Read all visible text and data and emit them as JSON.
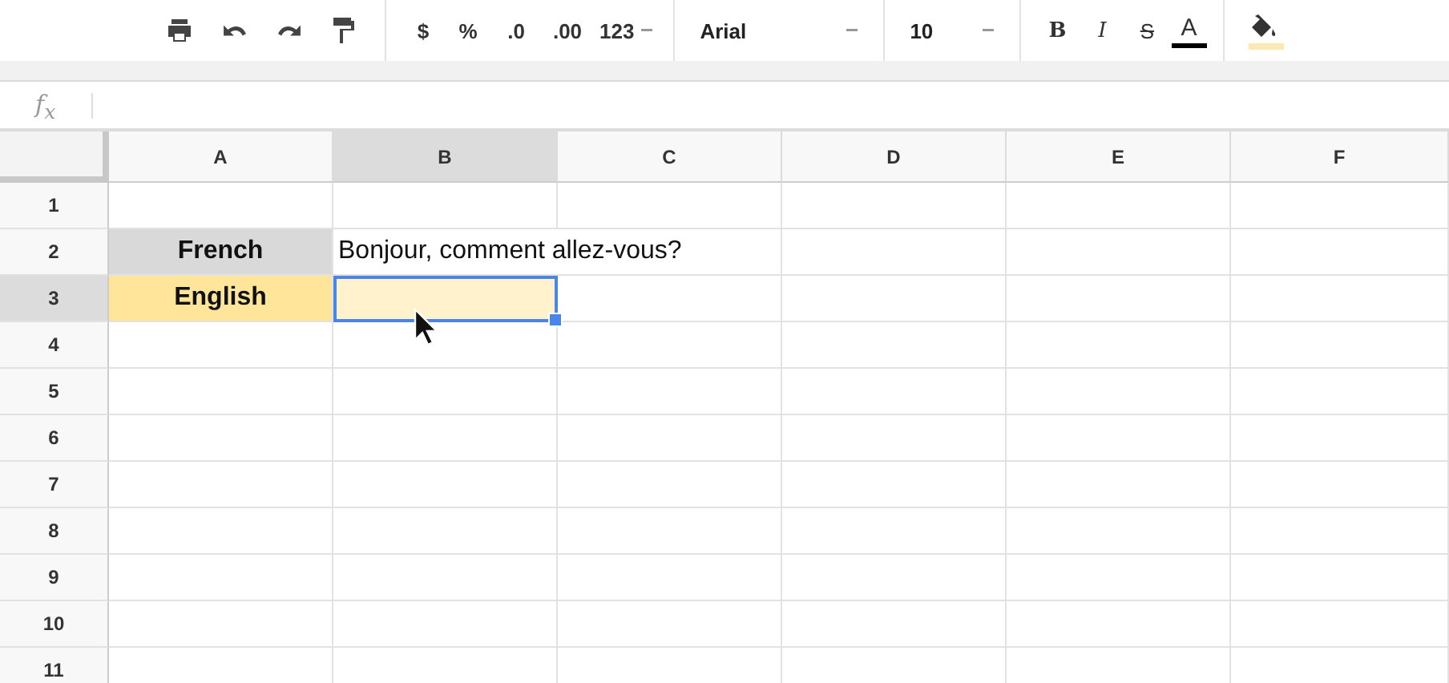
{
  "toolbar": {
    "groups": [
      [
        {
          "kind": "print"
        },
        {
          "kind": "undo"
        },
        {
          "kind": "redo"
        },
        {
          "kind": "paint-format"
        }
      ],
      [
        {
          "kind": "text",
          "label": "$"
        },
        {
          "kind": "text",
          "label": "%"
        },
        {
          "kind": "decimal-less",
          "label": ".0"
        },
        {
          "kind": "decimal-more",
          "label": ".00"
        },
        {
          "kind": "dropdown",
          "label": "123"
        }
      ],
      [
        {
          "kind": "font",
          "label": "Arial"
        }
      ],
      [
        {
          "kind": "size",
          "label": "10"
        }
      ],
      [
        {
          "kind": "bold",
          "label": "B"
        },
        {
          "kind": "italic",
          "label": "I"
        },
        {
          "kind": "strike",
          "label": "S"
        },
        {
          "kind": "text-color",
          "label": "A"
        }
      ],
      [
        {
          "kind": "fill-color"
        }
      ]
    ]
  },
  "formula_bar": {
    "label": "f$_{x}$"
  },
  "sheet": {
    "columns": [
      {
        "label": "A",
        "selected": false
      },
      {
        "label": "B",
        "selected": true
      },
      {
        "label": "C",
        "selected": false
      },
      {
        "label": "D",
        "selected": false
      },
      {
        "label": "E",
        "selected": false
      },
      {
        "label": "F",
        "selected": false
      }
    ],
    "rows": [
      {
        "label": "1",
        "selected": false,
        "cells": [
          {
            "selected": false
          },
          {
            "selected": false
          },
          {
            "selected": false
          },
          {
            "selected": false
          },
          {
            "selected": false
          },
          {
            "selected": false
          }
        ]
      },
      {
        "label": "2",
        "selected": false,
        "cells": [
          {
            "text": "French",
            "bold": true,
            "color": "#d9d9d9",
            "selected": false
          },
          {
            "text": "Bonjour, comment allez-vous?",
            "overflows": true,
            "selected": false
          },
          {
            "selected": false
          },
          {
            "selected": false
          },
          {
            "selected": false
          }
        ]
      },
      {
        "label": "3",
        "selected": true,
        "cells": [
          {
            "text": "English",
            "bold": true,
            "color": "#ffe599",
            "selected": false
          },
          {
            "color": "#fff2cc",
            "selected": true
          },
          {
            "selected": false
          },
          {
            "selected": false
          },
          {
            "selected": false
          },
          {
            "selected": false
          }
        ]
      },
      {
        "label": "4",
        "selected": false,
        "cells": [
          {
            "selected": false
          },
          {
            "selected": false
          },
          {
            "selected": false
          },
          {
            "selected": false
          },
          {
            "selected": false
          },
          {
            "selected": false
          }
        ]
      },
      {
        "label": "5",
        "selected": false,
        "cells": [
          {
            "selected": false
          },
          {
            "selected": false
          },
          {
            "selected": false
          },
          {
            "selected": false
          },
          {
            "selected": false
          },
          {
            "selected": false
          }
        ]
      },
      {
        "label": "6",
        "selected": false,
        "cells": [
          {
            "selected": false
          },
          {
            "selected": false
          },
          {
            "selected": false
          },
          {
            "selected": false
          },
          {
            "selected": false
          },
          {
            "selected": false
          }
        ]
      },
      {
        "label": "7",
        "selected": false,
        "cells": [
          {
            "selected": false
          },
          {
            "selected": false
          },
          {
            "selected": false
          },
          {
            "selected": false
          },
          {
            "selected": false
          },
          {
            "selected": false
          }
        ]
      },
      {
        "label": "8",
        "selected": false,
        "cells": [
          {
            "selected": false
          },
          {
            "selected": false
          },
          {
            "selected": false
          },
          {
            "selected": false
          },
          {
            "selected": false
          },
          {
            "selected": false
          }
        ]
      },
      {
        "label": "9",
        "selected": false,
        "cells": [
          {
            "selected": false
          },
          {
            "selected": false
          },
          {
            "selected": false
          },
          {
            "selected": false
          },
          {
            "selected": false
          },
          {
            "selected": false
          }
        ]
      },
      {
        "label": "10",
        "selected": false,
        "cells": [
          {
            "selected": false
          },
          {
            "selected": false
          },
          {
            "selected": false
          },
          {
            "selected": false
          },
          {
            "selected": false
          },
          {
            "selected": false
          }
        ]
      },
      {
        "label": "11",
        "selected": false,
        "cells": [
          {
            "selected": false
          },
          {
            "selected": false
          },
          {
            "selected": false
          },
          {
            "selected": false
          },
          {
            "selected": false
          },
          {
            "selected": false
          }
        ]
      }
    ]
  }
}
